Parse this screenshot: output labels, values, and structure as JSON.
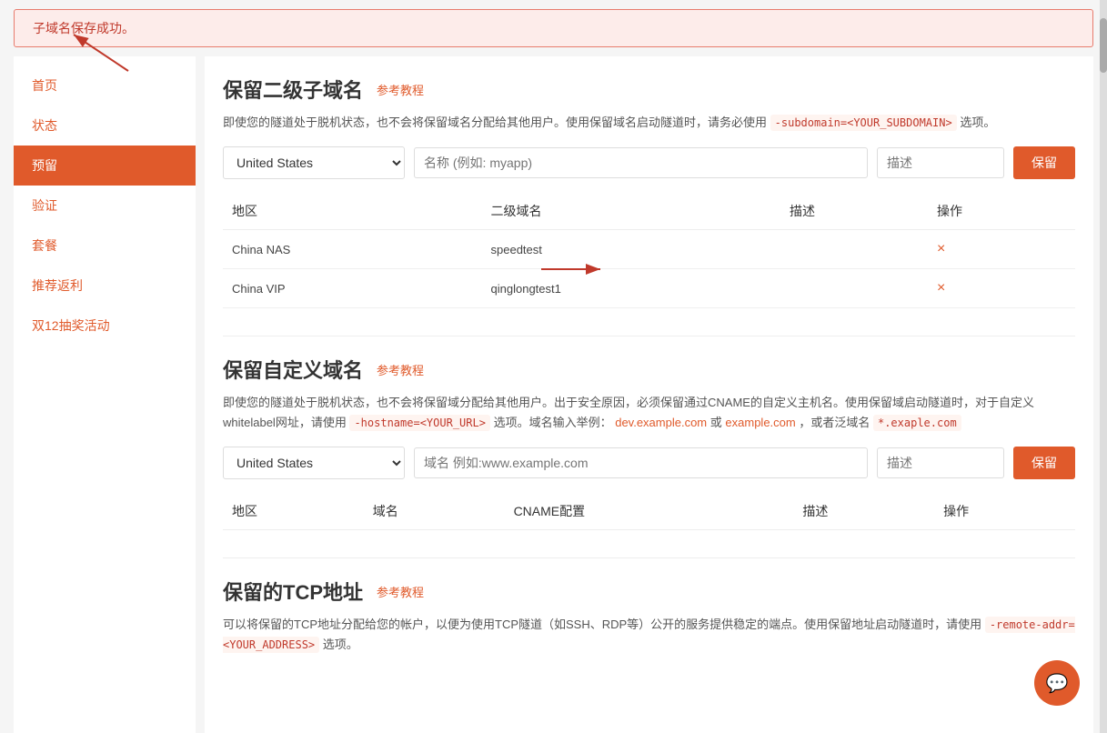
{
  "banner": {
    "message": "子域名保存成功。"
  },
  "sidebar": {
    "items": [
      {
        "label": "首页",
        "id": "home",
        "active": false
      },
      {
        "label": "状态",
        "id": "status",
        "active": false
      },
      {
        "label": "预留",
        "id": "reserve",
        "active": true
      },
      {
        "label": "验证",
        "id": "verify",
        "active": false
      },
      {
        "label": "套餐",
        "id": "plan",
        "active": false
      },
      {
        "label": "推荐返利",
        "id": "referral",
        "active": false
      },
      {
        "label": "双12抽奖活动",
        "id": "lottery",
        "active": false
      }
    ]
  },
  "section1": {
    "title": "保留二级子域名",
    "ref_link": "参考教程",
    "desc1": "即使您的隧道处于脱机状态，也不会将保留域名分配给其他用户。使用保留域名启动隧道时，请务必使用",
    "highlight1": "-subdomain=<YOUR_SUBDOMAIN>",
    "desc2": "选项。",
    "select_placeholder": "United States",
    "input_placeholder": "名称 (例如: myapp)",
    "desc_placeholder": "描述",
    "save_btn": "保留",
    "table": {
      "headers": [
        "地区",
        "二级域名",
        "描述",
        "操作"
      ],
      "rows": [
        {
          "region": "China NAS",
          "subdomain": "speedtest",
          "desc": "",
          "op": "×"
        },
        {
          "region": "China VIP",
          "subdomain": "qinglongtest1",
          "desc": "",
          "op": "×"
        }
      ]
    }
  },
  "section2": {
    "title": "保留自定义域名",
    "ref_link": "参考教程",
    "desc1": "即使您的隧道处于脱机状态，也不会将保留域分配给其他用户。出于安全原因，必须保留通过CNAME的自定义主机名。使用保留域启动隧道时，对于自定义whitelabel网址，请使用",
    "highlight1": "-hostname=<YOUR_URL>",
    "desc2": "选项。域名输入举例：",
    "link1": "dev.example.com",
    "desc3": "或",
    "link2": "example.com",
    "desc4": "，或者泛域名",
    "highlight2": "*.exaple.com",
    "select_placeholder": "United States",
    "input_placeholder": "域名 例如:www.example.com",
    "desc_placeholder": "描述",
    "save_btn": "保留",
    "table": {
      "headers": [
        "地区",
        "域名",
        "CNAME配置",
        "描述",
        "操作"
      ]
    }
  },
  "section3": {
    "title": "保留的TCP地址",
    "ref_link": "参考教程",
    "desc1": "可以将保留的TCP地址分配给您的帐户，以便为使用TCP隧道（如SSH、RDP等）公开的服务提供稳定的端点。使用保留地址启动隧道时，请使用",
    "highlight1": "-remote-addr=<YOUR_ADDRESS>",
    "desc2": "选项。"
  },
  "chat_icon": "💬"
}
